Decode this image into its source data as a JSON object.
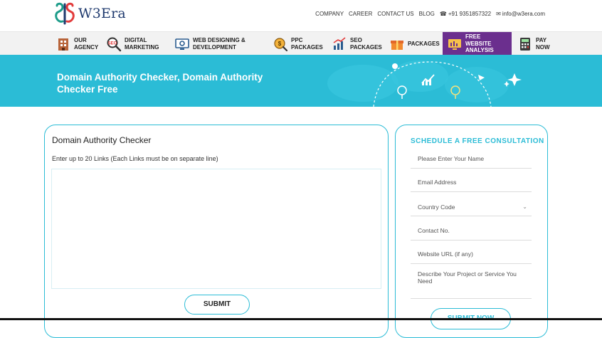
{
  "brand": {
    "name": "W3Era"
  },
  "top_links": {
    "company": "COMPANY",
    "career": "CAREER",
    "contact": "CONTACT US",
    "blog": "BLOG",
    "phone": "+91 9351857322",
    "email": "info@w3era.com"
  },
  "nav": {
    "items": [
      {
        "line1": "OUR",
        "line2": "AGENCY"
      },
      {
        "line1": "DIGITAL",
        "line2": "MARKETING"
      },
      {
        "line1": "WEB DESIGNING &",
        "line2": "DEVELOPMENT"
      },
      {
        "line1": "PPC",
        "line2": "PACKAGES"
      },
      {
        "line1": "SEO",
        "line2": "PACKAGES"
      },
      {
        "line1": "PACKAGES",
        "line2": ""
      },
      {
        "line1": "FREE WEBSITE",
        "line2": "ANALYSIS"
      },
      {
        "line1": "PAY",
        "line2": "NOW"
      }
    ]
  },
  "banner": {
    "title": "Domain Authority Checker, Domain Authority Checker Free"
  },
  "checker": {
    "title": "Domain Authority Checker",
    "instruction": "Enter up to 20 Links (Each Links must be on separate line)",
    "links_value": "",
    "submit_label": "SUBMIT"
  },
  "consultation": {
    "title": "SCHEDULE A FREE CONSULTATION",
    "fields": {
      "name": "Please Enter Your Name",
      "email": "Email Address",
      "country": "Country Code",
      "contact": "Contact No.",
      "website": "Website URL (if any)",
      "project": "Describe Your Project or Service You Need"
    },
    "submit_label": "SUBMIT NOW"
  },
  "colors": {
    "accent": "#2bbcd6",
    "active_nav": "#6b2f8e",
    "brand_text": "#1f3a6e"
  },
  "icons": [
    "phone-icon",
    "mail-icon",
    "chevron-down-icon"
  ]
}
